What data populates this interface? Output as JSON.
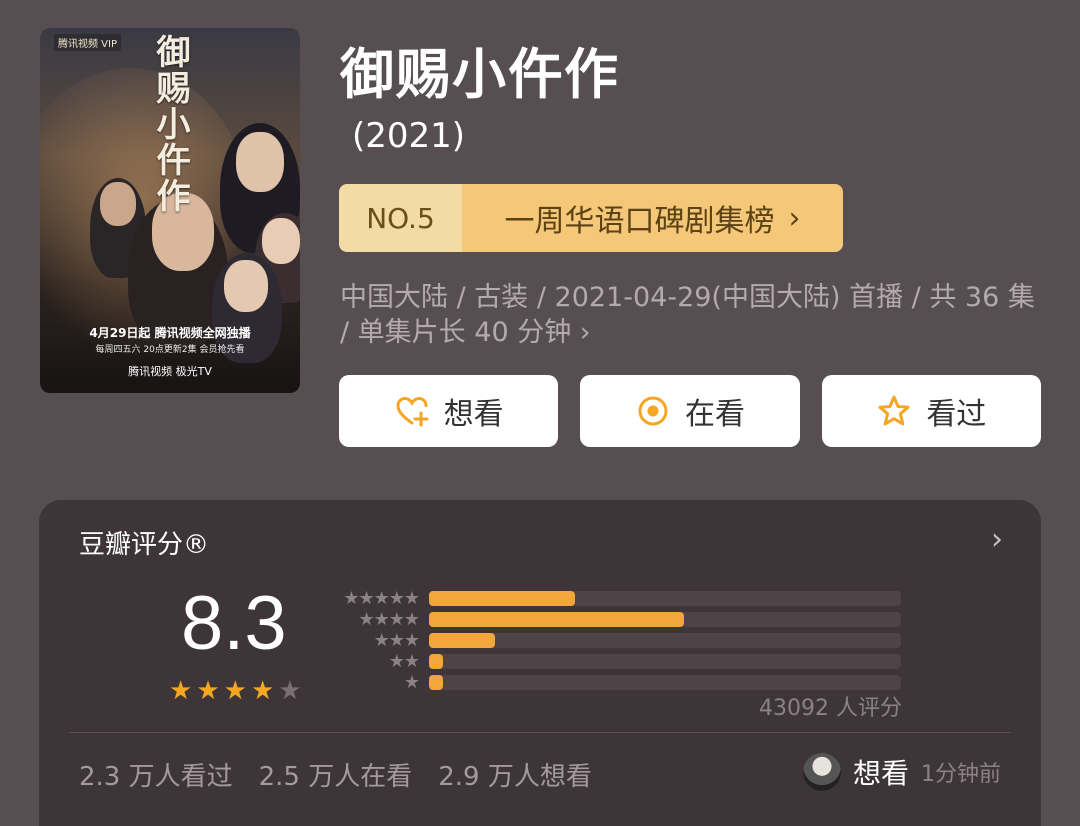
{
  "poster": {
    "brand": "腾讯视频 VIP",
    "title_art": "御赐小仵作",
    "date_line": "4月29日起 腾讯视频全网独播",
    "schedule_line": "每周四五六 20点更新2集 会员抢先看",
    "platforms": "腾讯视频  极光TV"
  },
  "show": {
    "title": "御赐小仵作",
    "year": "(2021)"
  },
  "ranking": {
    "number": "NO.5",
    "label": "一周华语口碑剧集榜"
  },
  "meta": {
    "text": "中国大陆 / 古装 / 2021-04-29(中国大陆) 首播 / 共 36 集 / 单集片长 40 分钟"
  },
  "actions": {
    "want": "想看",
    "watching": "在看",
    "watched": "看过"
  },
  "rating": {
    "title": "豆瓣评分®",
    "score": "8.3",
    "stars_filled": 4,
    "stars_total": 5,
    "distribution": [
      {
        "stars": "★★★★★",
        "fraction": 0.31
      },
      {
        "stars": "★★★★",
        "fraction": 0.54
      },
      {
        "stars": "★★★",
        "fraction": 0.14
      },
      {
        "stars": "★★",
        "fraction": 0.03
      },
      {
        "stars": "★",
        "fraction": 0.03
      }
    ],
    "count": "43092 人评分",
    "stats": {
      "watched": "2.3 万人看过",
      "watching": "2.5 万人在看",
      "want": "2.9 万人想看"
    },
    "activity": {
      "label": "想看",
      "time": "1分钟前"
    }
  },
  "colors": {
    "background": "#574e52",
    "card": "#3e3538",
    "accent": "#f5a623",
    "rank_light": "#f3dba6",
    "rank_dark": "#f5c778"
  }
}
